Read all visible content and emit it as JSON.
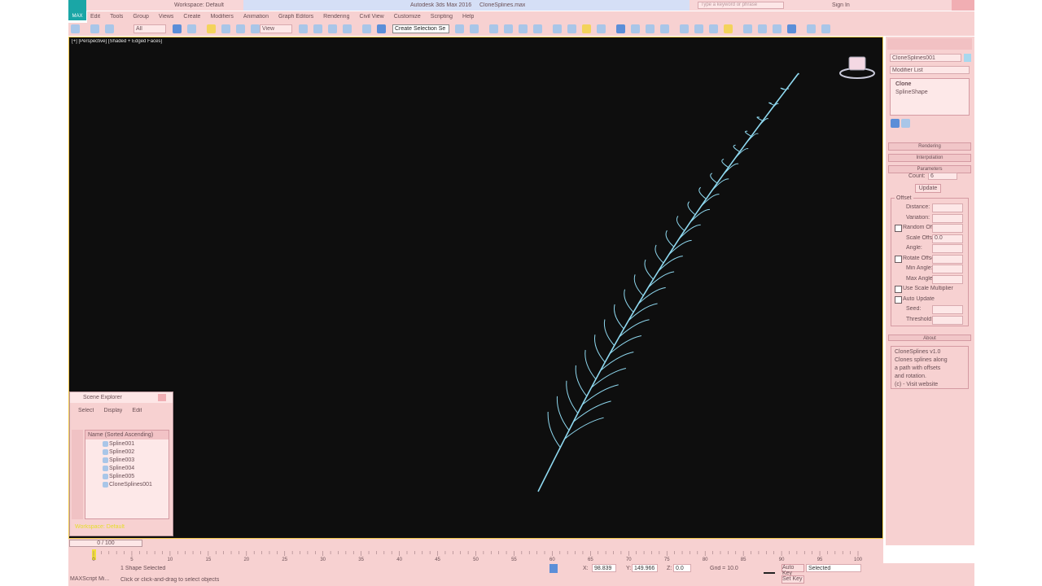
{
  "app": {
    "title": "Autodesk 3ds Max 2016",
    "file": "CloneSplines.max",
    "logo": "MAX",
    "workspace": "Workspace: Default",
    "search_placeholder": "Type a keyword or phrase",
    "sign_in": "Sign In"
  },
  "menu": [
    "Edit",
    "Tools",
    "Group",
    "Views",
    "Create",
    "Modifiers",
    "Animation",
    "Graph Editors",
    "Rendering",
    "Civil View",
    "Customize",
    "Scripting",
    "Help"
  ],
  "toolbar": {
    "selection_filter": "All",
    "ref_coord": "View",
    "named_selection": "Create Selection Se"
  },
  "viewport": {
    "label": "[+] [Perspective] [Shaded + Edged Faces]",
    "background": "#0e0e0e",
    "fern_color": "#8fd9f0"
  },
  "command_panel": {
    "object_name": "CloneSplines001",
    "modifier_list": "Modifier List",
    "stack": [
      "Clone",
      "SplineShape"
    ],
    "rollouts": [
      "Rendering",
      "Interpolation",
      "Parameters"
    ],
    "params": {
      "count_label": "Count:",
      "count_value": "6",
      "update_button": "Update",
      "group_title": "Offset",
      "rows": [
        {
          "label": "Distance:",
          "value": "",
          "checkbox": false
        },
        {
          "label": "Variation:",
          "value": "",
          "checkbox": false
        },
        {
          "label": "Random Offset:",
          "value": "",
          "checkbox": true
        },
        {
          "label": "Scale Offset:",
          "value": "0.0",
          "checkbox": false
        },
        {
          "label": "Angle:",
          "value": "",
          "checkbox": false
        },
        {
          "label": "Rotate Offset:",
          "value": "",
          "checkbox": true
        },
        {
          "label": "Min Angle:",
          "value": "",
          "checkbox": false
        },
        {
          "label": "Max Angle:",
          "value": "",
          "checkbox": false
        },
        {
          "label": "Use Scale Multiplier",
          "value": "",
          "checkbox": true
        },
        {
          "label": "Auto Update",
          "value": "",
          "checkbox": true
        },
        {
          "label": "Seed:",
          "value": "",
          "checkbox": false
        },
        {
          "label": "Threshold:",
          "value": "",
          "checkbox": false
        }
      ]
    },
    "about_title": "About",
    "about_lines": [
      "CloneSplines v1.0",
      "Clones splines along",
      "a path with offsets",
      "and rotation.",
      "(c) - Visit website"
    ]
  },
  "scene_explorer": {
    "title": "Scene Explorer",
    "menu": [
      "Select",
      "Display",
      "Edit"
    ],
    "root": "Name (Sorted Ascending)",
    "items": [
      "Spline001",
      "Spline002",
      "Spline003",
      "Spline004",
      "Spline005",
      "CloneSplines001"
    ],
    "footer": "Workspace: Default"
  },
  "timeline": {
    "frame_label": "0 / 100",
    "ticks": [
      "0",
      "5",
      "10",
      "15",
      "20",
      "25",
      "30",
      "35",
      "40",
      "45",
      "50",
      "55",
      "60",
      "65",
      "70",
      "75",
      "80",
      "85",
      "90",
      "95",
      "100"
    ]
  },
  "status": {
    "selected": "1 Shape Selected",
    "prompt": "Click or click-and-drag to select objects",
    "x": "98.839",
    "y": "149.966",
    "z": "0.0",
    "grid": "Grid = 10.0",
    "auto_key": "Auto Key",
    "set_key": "Set Key",
    "key_filter": "Selected",
    "maxscript": "MAXScript Mi..."
  }
}
